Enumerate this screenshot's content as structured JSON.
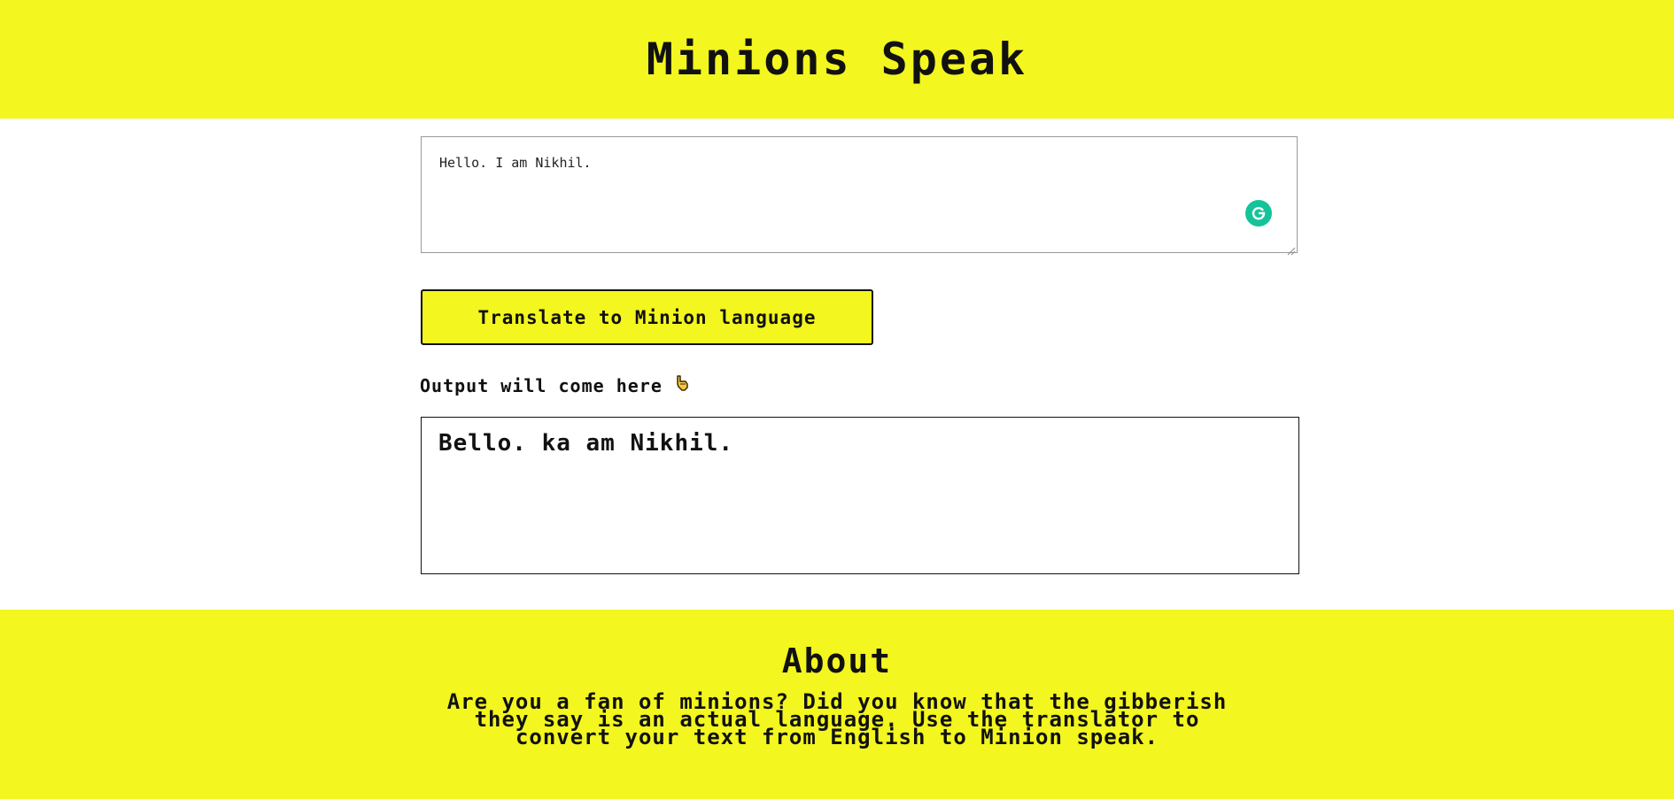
{
  "header": {
    "title": "Minions Speak"
  },
  "input": {
    "value": "Hello. I am Nikhil."
  },
  "translate_button": {
    "label": "Translate to Minion language"
  },
  "output": {
    "label": "Output will come here",
    "pointer_icon": "pointing-down-hand-icon",
    "value": "Bello. ka am Nikhil."
  },
  "about": {
    "title": "About",
    "text": "Are you a fan of minions? Did you know that the gibberish they say is an actual language. Use the translator to convert your text from English to Minion speak."
  },
  "colors": {
    "brand_yellow": "#f3f61f",
    "grammarly_green": "#15c39a",
    "text": "#111111"
  },
  "icons": {
    "grammarly": "grammarly-icon"
  }
}
